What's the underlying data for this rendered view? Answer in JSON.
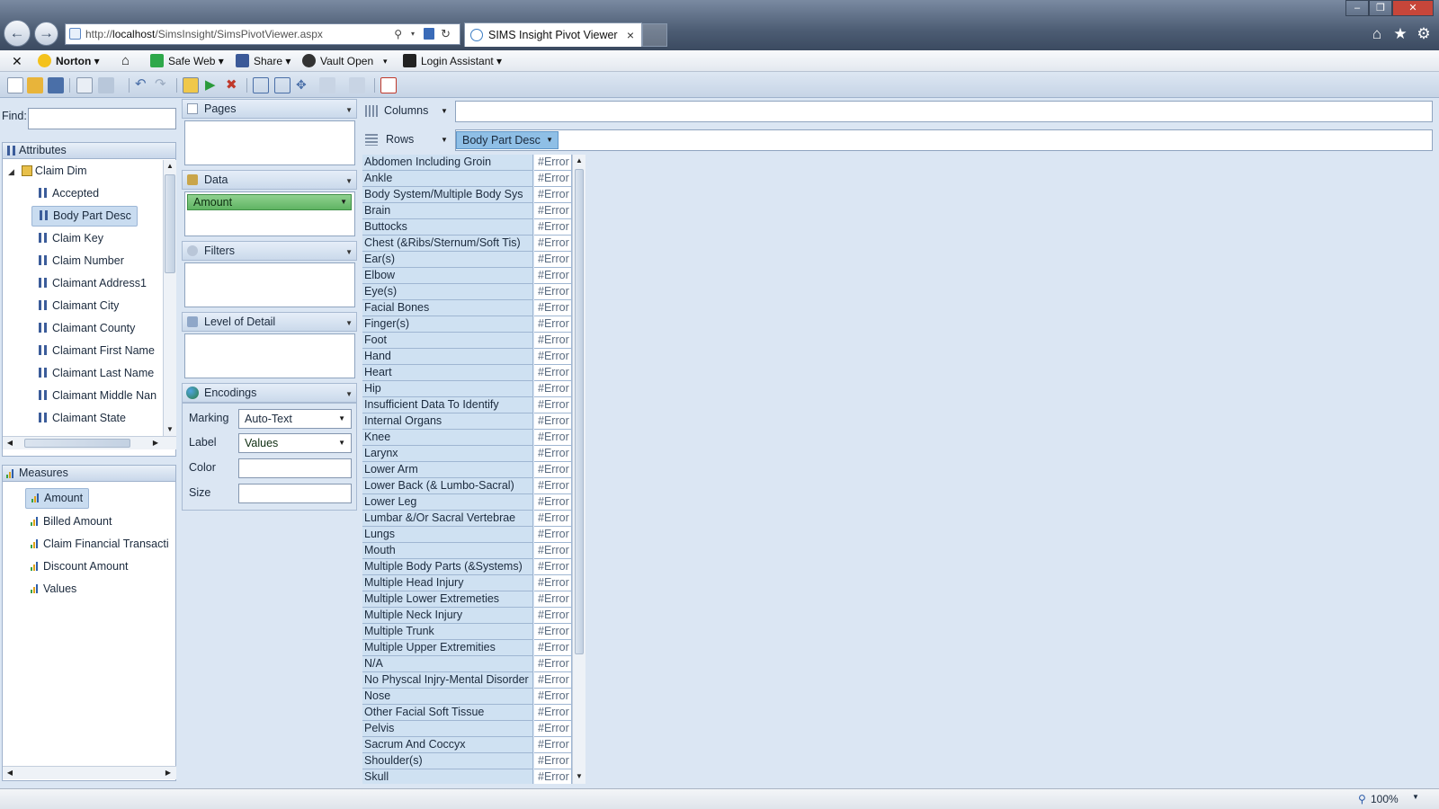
{
  "browser": {
    "url_prefix": "http://",
    "url_host": "localhost",
    "url_path": "/SimsInsight/SimsPivotViewer.aspx",
    "tab_title": "SIMS Insight Pivot Viewer",
    "tab_close": "×",
    "favorites": {
      "norton": "Norton ▾",
      "safe_web": "Safe Web ▾",
      "share": "Share ▾",
      "vault": "Vault Open",
      "vault_arrow": "▾",
      "login": "Login Assistant ▾"
    },
    "zoom": "100%"
  },
  "sidebar": {
    "find_label": "Find:",
    "find_value": "",
    "attributes_header": "Attributes",
    "tree_root": "Claim Dim",
    "attributes": [
      "Accepted",
      "Body Part Desc",
      "Claim Key",
      "Claim Number",
      "Claimant Address1",
      "Claimant City",
      "Claimant County",
      "Claimant First Name",
      "Claimant Last Name",
      "Claimant Middle Nan",
      "Claimant State"
    ],
    "selected_attribute": "Body Part Desc",
    "measures_header": "Measures",
    "measures": [
      "Amount",
      "Billed Amount",
      "Claim Financial Transacti",
      "Discount Amount",
      "Values"
    ],
    "selected_measure": "Amount"
  },
  "config": {
    "pages": "Pages",
    "data": "Data",
    "data_item": "Amount",
    "filters": "Filters",
    "level_of_detail": "Level of Detail",
    "encodings": "Encodings",
    "marking_label": "Marking",
    "marking_value": "Auto-Text",
    "label_label": "Label",
    "label_value": "Values",
    "color_label": "Color",
    "color_value": "",
    "size_label": "Size",
    "size_value": ""
  },
  "shelves": {
    "columns": "Columns",
    "rows": "Rows",
    "rows_pill": "Body Part Desc"
  },
  "grid": {
    "error_value": "#Error",
    "rows": [
      "Abdomen Including Groin",
      "Ankle",
      "Body System/Multiple Body Sys",
      "Brain",
      "Buttocks",
      "Chest (&Ribs/Sternum/Soft Tis)",
      "Ear(s)",
      "Elbow",
      "Eye(s)",
      "Facial Bones",
      "Finger(s)",
      "Foot",
      "Hand",
      "Heart",
      "Hip",
      "Insufficient Data To Identify",
      "Internal Organs",
      "Knee",
      "Larynx",
      "Lower Arm",
      "Lower Back (& Lumbo-Sacral)",
      "Lower Leg",
      "Lumbar &/Or Sacral Vertebrae",
      "Lungs",
      "Mouth",
      "Multiple Body Parts (&Systems)",
      "Multiple Head Injury",
      "Multiple Lower Extremeties",
      "Multiple Neck Injury",
      "Multiple Trunk",
      "Multiple Upper Extremities",
      "N/A",
      "No Physcal Injry-Mental Disorder",
      "Nose",
      "Other Facial Soft Tissue",
      "Pelvis",
      "Sacrum And Coccyx",
      "Shoulder(s)",
      "Skull"
    ]
  },
  "colors": {
    "accent_green": "#5fb463",
    "selection_blue": "#c9dcf0",
    "panel_bg": "#dbe6f3"
  }
}
